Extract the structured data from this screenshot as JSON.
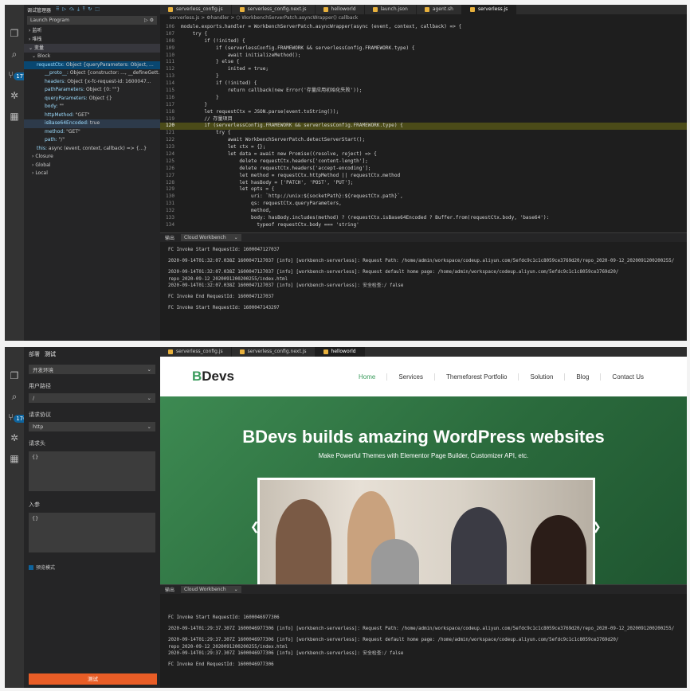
{
  "top": {
    "debug_title": "调试管理器",
    "launch": "Launch Program",
    "sections": [
      "监听",
      "堆栈",
      "变量"
    ],
    "block": "Block",
    "variables": [
      {
        "k": "requestCtx:",
        "v": "Object {queryParameters: Object, ...",
        "cls": "sel"
      },
      {
        "k": "__proto__:",
        "v": "Object {constructor: ..., __defineGett...",
        "cls": ""
      },
      {
        "k": "headers:",
        "v": "Object {x-fc-request-id: 1600047...",
        "cls": ""
      },
      {
        "k": "pathParameters:",
        "v": "Object {0: \"\"}",
        "cls": ""
      },
      {
        "k": "queryParameters:",
        "v": "Object {}",
        "cls": ""
      },
      {
        "k": "body:",
        "v": "\"\"",
        "cls": ""
      },
      {
        "k": "httpMethod:",
        "v": "\"GET\"",
        "cls": ""
      },
      {
        "k": "isBase64Encoded:",
        "v": "true",
        "cls": "dim"
      },
      {
        "k": "method:",
        "v": "\"GET\"",
        "cls": ""
      },
      {
        "k": "path:",
        "v": "\"/\"",
        "cls": ""
      },
      {
        "k": "this:",
        "v": "async (event, context, callback) => {...}",
        "cls": ""
      }
    ],
    "scopes": [
      "Closure",
      "Global",
      "Local"
    ],
    "badge": "177",
    "tabs": [
      "serverless_config.js",
      "serverless_config.next.js",
      "helloworld",
      "launch.json",
      "agent.sh",
      "serverless.js"
    ],
    "breadcrumb": "serverless.js  >  ⚙handler  >  ⬡ WorkbenchServerPatch.asyncWrapper() callback",
    "code": [
      [
        "106",
        "module.exports.handler = WorkbenchServerPatch.asyncWrapper(async (event, context, callback) => {"
      ],
      [
        "107",
        "    try {"
      ],
      [
        "108",
        "        if (!inited) {"
      ],
      [
        "109",
        "            if (serverlessConfig.FRAMEWORK && serverlessConfig.FRAMEWORK.type) {"
      ],
      [
        "110",
        "                await initializeMethod();"
      ],
      [
        "111",
        "            } else {"
      ],
      [
        "112",
        "                inited = true;"
      ],
      [
        "113",
        "            }"
      ],
      [
        "114",
        "            if (!inited) {"
      ],
      [
        "115",
        "                return callback(new Error('存量应用初始化失败'));"
      ],
      [
        "116",
        "            }"
      ],
      [
        "117",
        "        }"
      ],
      [
        "118",
        "        let requestCtx = JSON.parse(event.toString());"
      ],
      [
        "119",
        "        // 存量项目"
      ],
      [
        "120",
        "        if (serverlessConfig.FRAMEWORK && serverlessConfig.FRAMEWORK.type) {"
      ],
      [
        "121",
        "            try {"
      ],
      [
        "122",
        "                await WorkbenchServerPatch.detectServerStart();"
      ],
      [
        "123",
        "                let ctx = {};"
      ],
      [
        "124",
        "                let data = await new Promise((resolve, reject) => {"
      ],
      [
        "125",
        "                    delete requestCtx.headers['content-length'];"
      ],
      [
        "126",
        "                    delete requestCtx.headers['accept-encoding'];"
      ],
      [
        "127",
        "                    let method = requestCtx.httpMethod || requestCtx.method"
      ],
      [
        "128",
        "                    let hasBody = ['PATCH', 'POST', 'PUT'];"
      ],
      [
        "129",
        "                    let opts = {"
      ],
      [
        "130",
        "                        uri: `http://unix:${socketPath}:${requestCtx.path}`,"
      ],
      [
        "131",
        "                        qs: requestCtx.queryParameters,"
      ],
      [
        "132",
        "                        method,"
      ],
      [
        "133",
        "                        body: hasBody.includes(method) ? (requestCtx.isBase64Encoded ? Buffer.from(requestCtx.body, 'base64'):"
      ],
      [
        "134",
        "                          typeof requestCtx.body === 'string'"
      ]
    ],
    "current_line": "120",
    "panel_tab": "输出",
    "panel_select": "Cloud Workbench",
    "log": [
      "FC Invoke Start RequestId: 1600047127037",
      "",
      "2020-09-14T01:32:07.038Z 1600047127037 [info] [workbench-serverless]: Request Path: /home/admin/workspace/codeup.aliyun.com/5efdc9c1c1c8059ce3769d20/repo_2020-09-12_2020091200200255/",
      "",
      "2020-09-14T01:32:07.038Z 1600047127037 [info] [workbench-serverless]: Request default home page: /home/admin/workspace/codeup.aliyun.com/5efdc9c1c1c8059ce3769d20/",
      "repo_2020-09-12_2020091200200255/index.html",
      "2020-09-14T01:32:07.038Z 1600047127037 [info] [workbench-serverless]: 安全检查:/ false",
      "",
      "FC Invoke End RequestId: 1600047127037",
      "",
      "FC Invoke Start RequestId: 1600047143297"
    ]
  },
  "bottom": {
    "badge": "176",
    "side_tabs": [
      "部署",
      "测试"
    ],
    "env": "开发环境",
    "path_label": "用户路径",
    "path_value": "/",
    "protocol_label": "请求协议",
    "protocol_value": "http",
    "headers_label": "请求头",
    "headers_value": "{}",
    "params_label": "入参",
    "params_value": "{}",
    "preview_label": "预览模式",
    "test_button": "测试",
    "tabs": [
      "serverless_config.js",
      "serverless_config.next.js",
      "helloworld"
    ],
    "logo_b": "B",
    "logo_rest": "Devs",
    "menu": [
      "Home",
      "Services",
      "Themeforest Portfolio",
      "Solution",
      "Blog",
      "Contact Us"
    ],
    "hero_title": "BDevs builds amazing WordPress websites",
    "hero_sub": "Make Powerful Themes with Elementor Page Builder, Customizer API, etc.",
    "panel_tab": "输出",
    "panel_select": "Cloud Workbench",
    "log": [
      "FC Invoke Start RequestId: 1600046977306",
      "",
      "2020-09-14T01:29:37.307Z 1600046977306 [info] [workbench-serverless]: Request Path: /home/admin/workspace/codeup.aliyun.com/5efdc9c1c1c8059ce3769d20/repo_2020-09-12_2020091200200255/",
      "",
      "2020-09-14T01:29:37.307Z 1600046977306 [info] [workbench-serverless]: Request default home page: /home/admin/workspace/codeup.aliyun.com/5efdc9c1c1c8059ce3769d20/",
      "repo_2020-09-12_2020091200200255/index.html",
      "2020-09-14T01:29:37.307Z 1600046977306 [info] [workbench-serverless]: 安全检查:/ false",
      "",
      "FC Invoke End RequestId: 1600046977306"
    ]
  }
}
